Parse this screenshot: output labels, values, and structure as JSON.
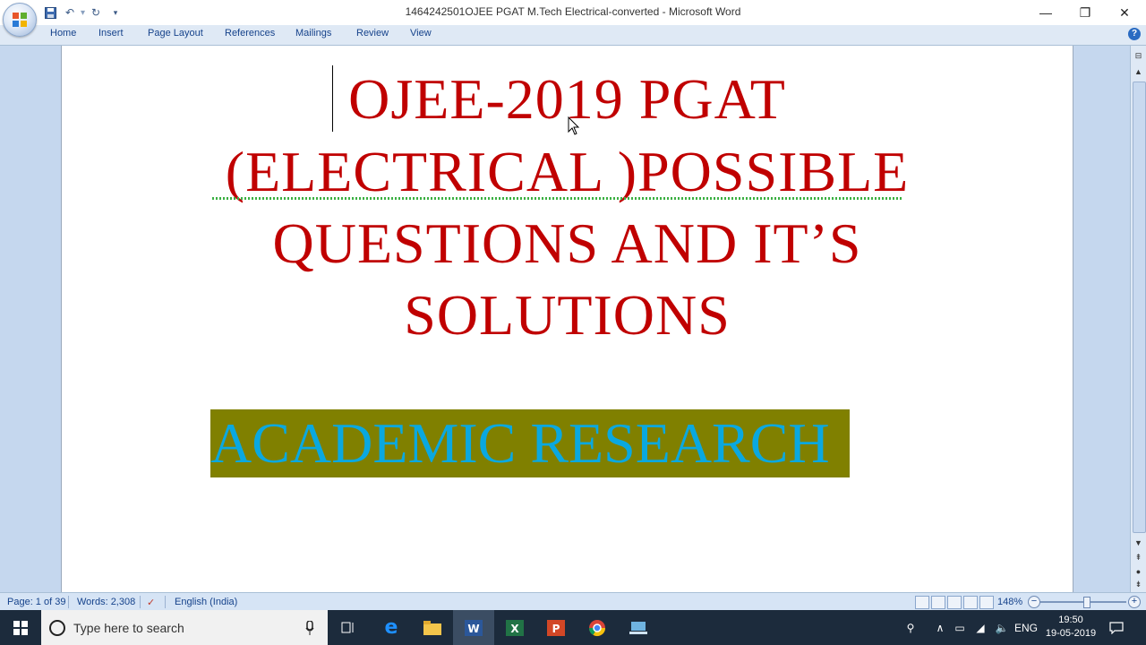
{
  "window": {
    "title": "1464242501OJEE PGAT M.Tech Electrical-converted - Microsoft Word"
  },
  "ribbon": {
    "tabs": [
      "Home",
      "Insert",
      "Page Layout",
      "References",
      "Mailings",
      "Review",
      "View"
    ]
  },
  "document": {
    "heading_lines": [
      "OJEE-2019 PGAT",
      "(ELECTRICAL )POSSIBLE",
      "QUESTIONS AND IT’S",
      "SOLUTIONS"
    ],
    "banner_text": "ACADEMIC RESEARCH",
    "heading_color": "#c00000",
    "banner_bg": "#808000",
    "banner_color": "#0aa8e0"
  },
  "statusbar": {
    "page": "Page: 1 of 39",
    "words": "Words: 2,308",
    "language": "English (India)",
    "zoom": "148%"
  },
  "taskbar": {
    "search_placeholder": "Type here to search",
    "language": "ENG",
    "time": "19:50",
    "date": "19-05-2019"
  }
}
